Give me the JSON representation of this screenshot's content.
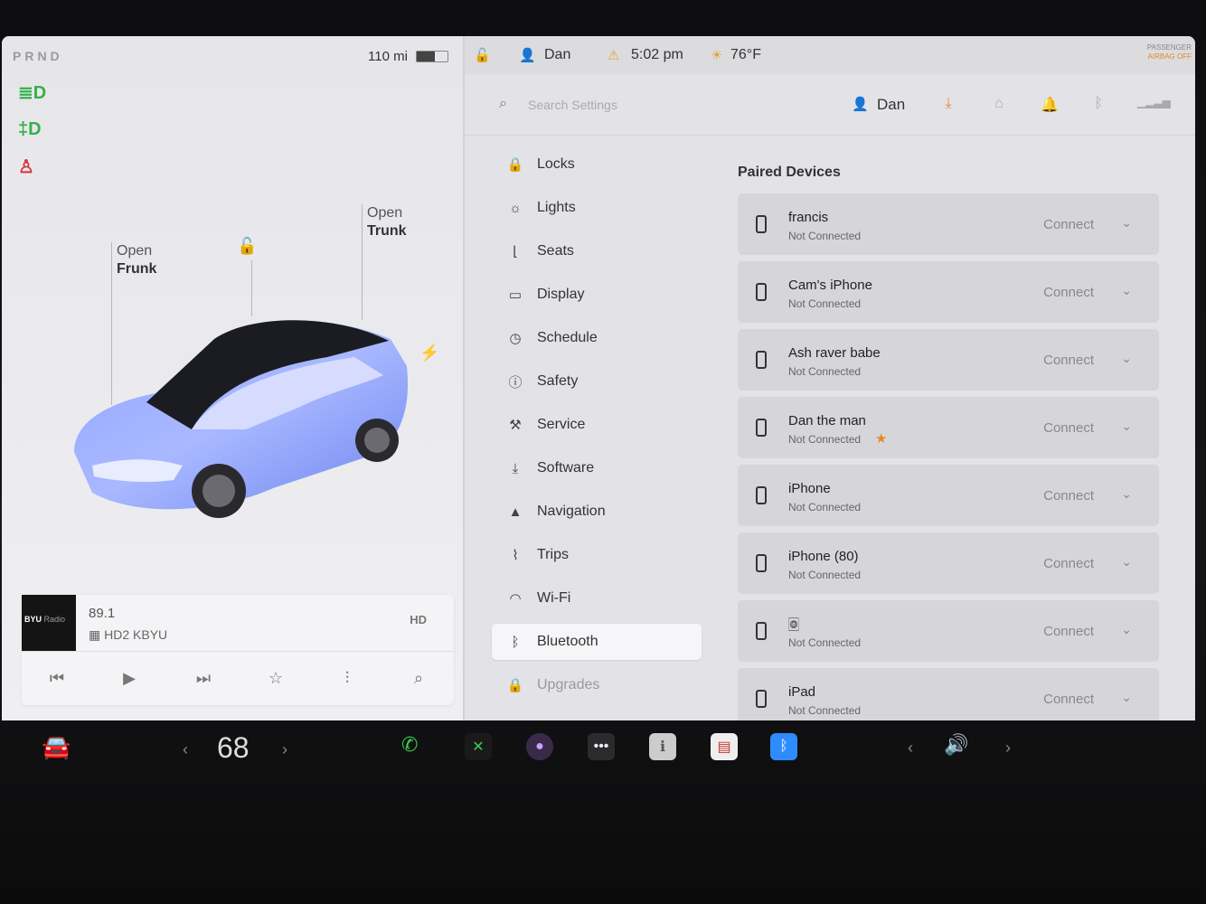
{
  "status": {
    "gear": "PRND",
    "range": "110 mi",
    "battery_level": 0.6,
    "user": "Dan",
    "time": "5:02 pm",
    "temp": "76°F",
    "airbag_line1": "PASSENGER",
    "airbag_line2": "AIRBAG OFF"
  },
  "car": {
    "frunk_label_1": "Open",
    "frunk_label_2": "Frunk",
    "trunk_label_1": "Open",
    "trunk_label_2": "Trunk"
  },
  "media": {
    "art_text": "BYU",
    "art_sub": "Radio",
    "frequency": "89.1",
    "station": "HD2 KBYU",
    "hd_badge": "HD"
  },
  "search": {
    "placeholder": "Search Settings"
  },
  "topbar": {
    "user": "Dan"
  },
  "menu": [
    {
      "label": "Locks",
      "icon": "lock-icon",
      "glyph": "🔒"
    },
    {
      "label": "Lights",
      "icon": "lights-icon",
      "glyph": "☼"
    },
    {
      "label": "Seats",
      "icon": "seat-icon",
      "glyph": "⌊"
    },
    {
      "label": "Display",
      "icon": "display-icon",
      "glyph": "▭"
    },
    {
      "label": "Schedule",
      "icon": "schedule-icon",
      "glyph": "◷"
    },
    {
      "label": "Safety",
      "icon": "safety-icon",
      "glyph": "ⓘ"
    },
    {
      "label": "Service",
      "icon": "wrench-icon",
      "glyph": "⚒"
    },
    {
      "label": "Software",
      "icon": "download-icon",
      "glyph": "⤓"
    },
    {
      "label": "Navigation",
      "icon": "navigation-icon",
      "glyph": "▲"
    },
    {
      "label": "Trips",
      "icon": "trips-icon",
      "glyph": "⌇"
    },
    {
      "label": "Wi-Fi",
      "icon": "wifi-icon",
      "glyph": "◠"
    },
    {
      "label": "Bluetooth",
      "icon": "bluetooth-icon",
      "glyph": "ᛒ"
    },
    {
      "label": "Upgrades",
      "icon": "upgrades-icon",
      "glyph": "🔒"
    }
  ],
  "paired": {
    "title": "Paired Devices",
    "devices": [
      {
        "name": "francis",
        "status": "Not Connected",
        "action": "Connect"
      },
      {
        "name": "Cam's iPhone",
        "status": "Not Connected",
        "action": "Connect"
      },
      {
        "name": "Ash raver babe",
        "status": "Not Connected",
        "action": "Connect"
      },
      {
        "name": "Dan the man",
        "status": "Not Connected",
        "action": "Connect",
        "star": "★"
      },
      {
        "name": "iPhone",
        "status": "Not Connected",
        "action": "Connect"
      },
      {
        "name": "iPhone (80)",
        "status": "Not Connected",
        "action": "Connect"
      },
      {
        "name": "🀙",
        "status": "Not Connected",
        "action": "Connect"
      },
      {
        "name": "iPad",
        "status": "Not Connected",
        "action": "Connect"
      }
    ]
  },
  "dock": {
    "temperature": "68"
  },
  "colors": {
    "accent_orange": "#e8862a",
    "bluetooth_blue": "#2f8cff",
    "phone_green": "#3ccf4e"
  }
}
